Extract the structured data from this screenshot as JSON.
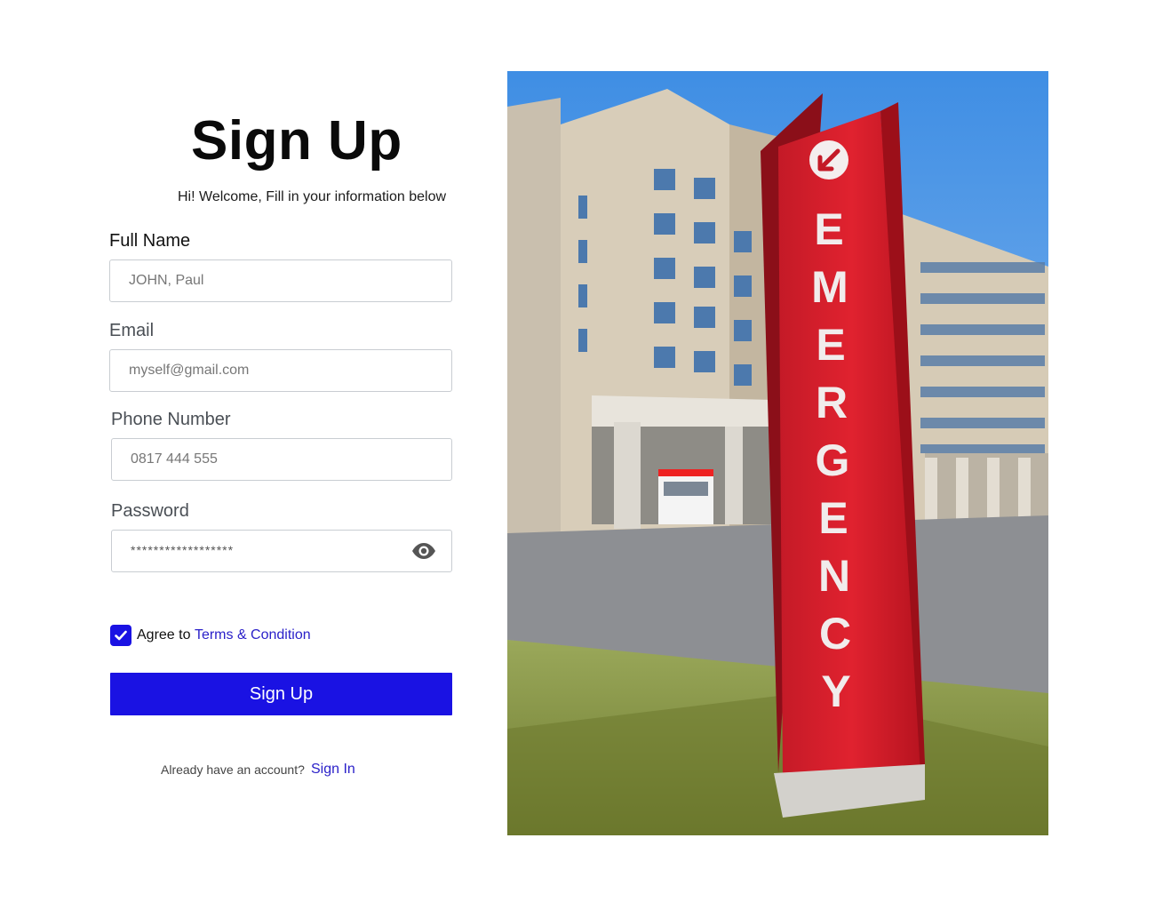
{
  "form": {
    "title": "Sign Up",
    "subtitle": "Hi! Welcome, Fill in your information below",
    "full_name": {
      "label": "Full Name",
      "placeholder": "JOHN, Paul"
    },
    "email": {
      "label": "Email",
      "placeholder": "myself@gmail.com"
    },
    "phone": {
      "label": "Phone Number",
      "placeholder": "0817 444 555"
    },
    "password": {
      "label": "Password",
      "value": "******************"
    },
    "agree_text": "Agree to",
    "terms_link": "Terms & Condition",
    "agree_checked": true,
    "submit_label": "Sign Up",
    "already_text": "Already have an account?",
    "signin_link": "Sign In"
  },
  "photo": {
    "sign_text": "EMERGENCY"
  },
  "colors": {
    "accent": "#1a12e3",
    "link": "#2b21c9",
    "sign_red": "#d8222f"
  }
}
